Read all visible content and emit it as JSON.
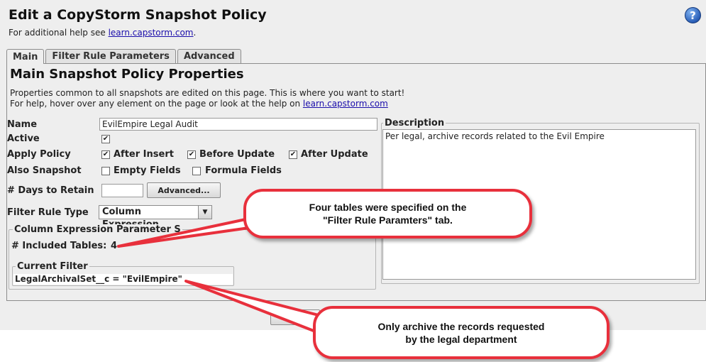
{
  "header": {
    "title": "Edit a CopyStorm Snapshot Policy",
    "help_prefix": "For additional help see ",
    "help_link": "learn.capstorm.com",
    "help_suffix": ".",
    "help_icon": "question-circle-icon"
  },
  "tabs": [
    {
      "label": "Main",
      "active": true
    },
    {
      "label": "Filter Rule Parameters",
      "active": false
    },
    {
      "label": "Advanced",
      "active": false
    }
  ],
  "main": {
    "heading": "Main Snapshot Policy Properties",
    "intro_line1": "Properties common to all snapshots are edited on this page. This is where you want to start!",
    "intro_line2_prefix": "For help, hover over any element on the page or look at the help on ",
    "intro_line2_link": "learn.capstorm.com",
    "name_label": "Name",
    "name_value": "EvilEmpire Legal Audit",
    "active_label": "Active",
    "active_checked": true,
    "apply_label": "Apply Policy",
    "after_insert": {
      "label": "After Insert",
      "checked": true
    },
    "before_update": {
      "label": "Before Update",
      "checked": true
    },
    "after_update": {
      "label": "After Update",
      "checked": true
    },
    "also_label": "Also Snapshot",
    "empty_fields": {
      "label": "Empty Fields",
      "checked": false
    },
    "formula_fields": {
      "label": "Formula Fields",
      "checked": false
    },
    "days_label": "# Days to Retain",
    "days_value": "",
    "advanced_button": "Advanced...",
    "filter_type_label": "Filter Rule Type",
    "filter_type_value": "Column Expression",
    "param_group_title": "Column Expression Parameter S",
    "included_tables_label": "# Included Tables:",
    "included_tables_value": "4",
    "current_filter_title": "Current Filter",
    "current_filter_value": "LegalArchivalSet__c = \"EvilEmpire\"",
    "description_title": "Description",
    "description_value": "Per legal, archive records related to the Evil Empire"
  },
  "callouts": {
    "tables_line1": "Four tables were specified on the",
    "tables_line2": "\"Filter Rule Paramters\" tab.",
    "archive_line1": "Only archive the records requested",
    "archive_line2": "by the legal department"
  },
  "colors": {
    "callout_border": "#e8303c",
    "link": "#1a0dab"
  }
}
